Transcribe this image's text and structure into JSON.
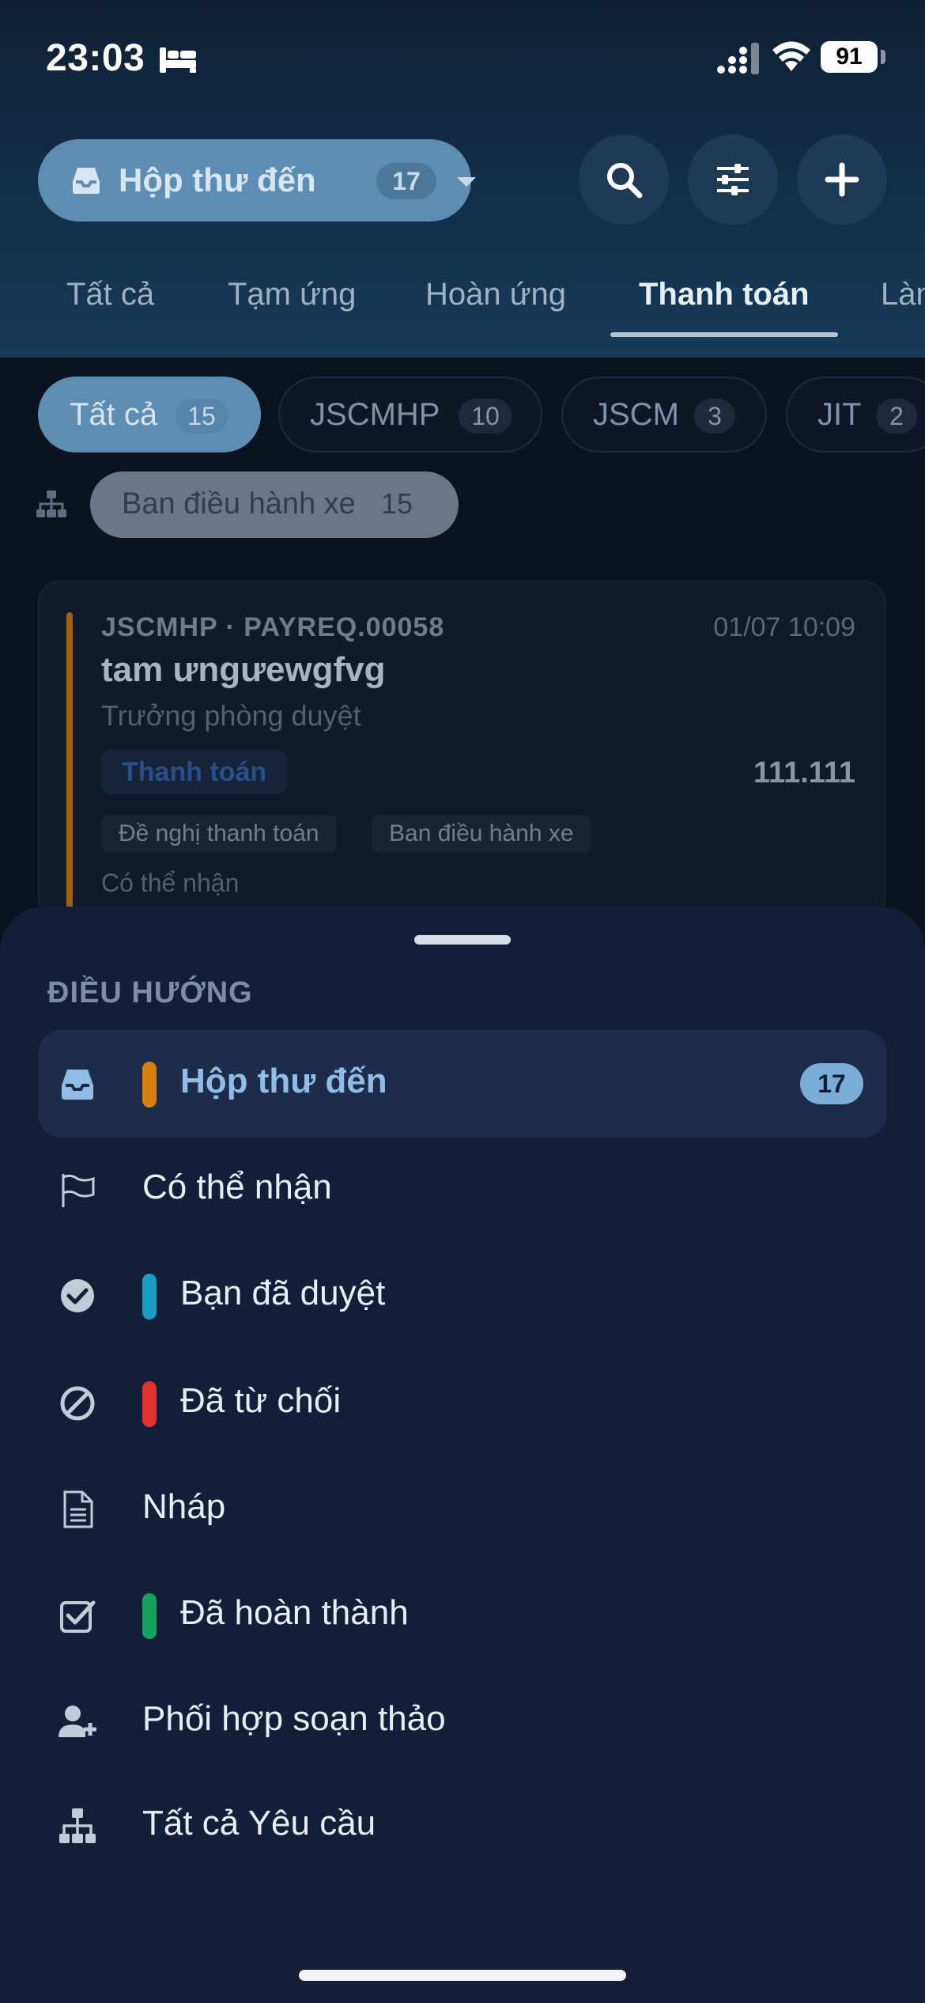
{
  "status_bar": {
    "time": "23:03",
    "battery": "91"
  },
  "header": {
    "inbox_label": "Hộp thư đến",
    "inbox_count": "17",
    "tabs": [
      {
        "label": "Tất cả"
      },
      {
        "label": "Tạm ứng"
      },
      {
        "label": "Hoàn ứng"
      },
      {
        "label": "Thanh toán",
        "active": true
      },
      {
        "label": "Làm"
      }
    ]
  },
  "filters": {
    "chips": [
      {
        "label": "Tất cả",
        "count": "15",
        "active": true
      },
      {
        "label": "JSCMHP",
        "count": "10"
      },
      {
        "label": "JSCM",
        "count": "3"
      },
      {
        "label": "JIT",
        "count": "2"
      }
    ],
    "department": {
      "label": "Ban điều hành xe",
      "count": "15"
    }
  },
  "card": {
    "code": "JSCMHP · PAYREQ.00058",
    "date": "01/07 10:09",
    "title": "tam ưngưewgfvg",
    "subtitle": "Trưởng phòng duyệt",
    "type_tag": "Thanh toán",
    "amount": "111.111",
    "tags": [
      "Đề nghị thanh toán",
      "Ban điều hành xe"
    ],
    "receivable": "Có thể nhận"
  },
  "sheet": {
    "section_label": "ĐIỀU HƯỚNG",
    "items": [
      {
        "label": "Hộp thư đến",
        "icon": "inbox-icon",
        "accent": "#d97f10",
        "badge": "17",
        "active": true
      },
      {
        "label": "Có thể nhận",
        "icon": "flag-icon"
      },
      {
        "label": "Bạn đã duyệt",
        "icon": "check-circle-icon",
        "accent": "#1a9cc4"
      },
      {
        "label": "Đã từ chối",
        "icon": "ban-icon",
        "accent": "#e0332e"
      },
      {
        "label": "Nháp",
        "icon": "document-icon"
      },
      {
        "label": "Đã hoàn thành",
        "icon": "checkbox-icon",
        "accent": "#13a35e"
      },
      {
        "label": "Phối hợp soạn thảo",
        "icon": "user-plus-icon"
      },
      {
        "label": "Tất cả Yêu cầu",
        "icon": "org-chart-icon"
      }
    ]
  }
}
